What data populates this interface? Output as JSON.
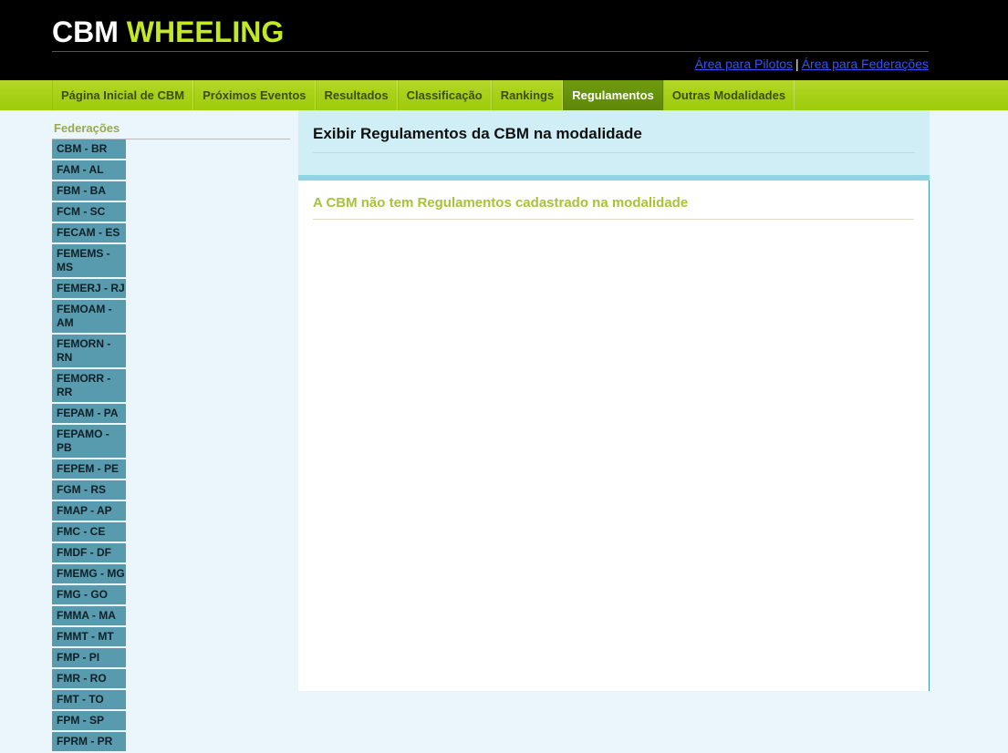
{
  "header": {
    "brand_first": "CBM",
    "brand_second": "WHEELING",
    "links": [
      {
        "label": "Área para Pilotos"
      },
      {
        "label": "Área para Federações"
      }
    ],
    "link_separator": "|"
  },
  "nav": {
    "items": [
      {
        "label": "Página Inicial de CBM",
        "active": false
      },
      {
        "label": "Próximos Eventos",
        "active": false
      },
      {
        "label": "Resultados",
        "active": false
      },
      {
        "label": "Classificação",
        "active": false
      },
      {
        "label": "Rankings",
        "active": false
      },
      {
        "label": "Regulamentos",
        "active": true
      },
      {
        "label": "Outras Modalidades",
        "active": false
      }
    ]
  },
  "sidebar": {
    "title": "Federações",
    "items": [
      {
        "label": "CBM - BR"
      },
      {
        "label": "FAM - AL"
      },
      {
        "label": "FBM - BA"
      },
      {
        "label": "FCM - SC"
      },
      {
        "label": "FECAM - ES"
      },
      {
        "label": "FEMEMS - MS"
      },
      {
        "label": "FEMERJ - RJ"
      },
      {
        "label": "FEMOAM - AM"
      },
      {
        "label": "FEMORN - RN"
      },
      {
        "label": "FEMORR - RR"
      },
      {
        "label": "FEPAM - PA"
      },
      {
        "label": "FEPAMO - PB"
      },
      {
        "label": "FEPEM - PE"
      },
      {
        "label": "FGM - RS"
      },
      {
        "label": "FMAP - AP"
      },
      {
        "label": "FMC - CE"
      },
      {
        "label": "FMDF - DF"
      },
      {
        "label": "FMEMG - MG"
      },
      {
        "label": "FMG - GO"
      },
      {
        "label": "FMMA - MA"
      },
      {
        "label": "FMMT - MT"
      },
      {
        "label": "FMP - PI"
      },
      {
        "label": "FMR - RO"
      },
      {
        "label": "FMT - TO"
      },
      {
        "label": "FPM - SP"
      },
      {
        "label": "FPRM - PR"
      }
    ]
  },
  "main": {
    "page_title": "Exibir Regulamentos da CBM na modalidade",
    "empty_message": "A CBM não tem Regulamentos cadastrado na modalidade"
  },
  "colors": {
    "brand_accent": "#c3e824",
    "nav_green": "#a8d119",
    "nav_active_green": "#6f9b10",
    "sidebar_item": "#589aae",
    "panel_head": "#cfeef5",
    "page_background": "#eaf6fb",
    "link_blue": "#3355ee",
    "message_olive": "#a8c23a"
  }
}
